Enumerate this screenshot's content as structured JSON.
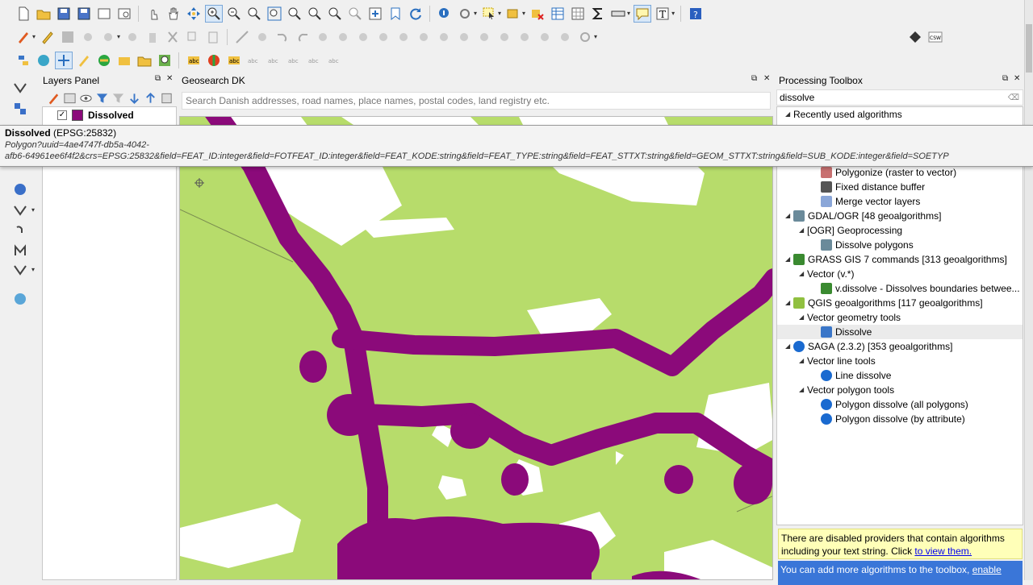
{
  "layers_panel": {
    "title": "Layers Panel",
    "layers": [
      {
        "name": "Dissolved",
        "checked": true,
        "color": "#8b0a7a"
      }
    ]
  },
  "geosearch": {
    "title": "Geosearch DK",
    "placeholder": "Search Danish addresses, road names, place names, postal codes, land registry etc."
  },
  "tooltip": {
    "layer_name": "Dissolved",
    "crs": "(EPSG:25832)",
    "uri_line1": "Polygon?uuid=4ae4747f-db5a-4042-",
    "uri_line2": "afb6-64961ee6f4f2&crs=EPSG:25832&field=FEAT_ID:integer&field=FOTFEAT_ID:integer&field=FEAT_KODE:string&field=FEAT_TYPE:string&field=FEAT_STTXT:string&field=GEOM_STTXT:string&field=SUB_KODE:integer&field=SOETYP"
  },
  "processing": {
    "title": "Processing Toolbox",
    "search_value": "dissolve",
    "tree": [
      {
        "label": "Recently used algorithms",
        "level": 0,
        "expander": "◢",
        "icon": "none"
      },
      {
        "label": "Polygonize (raster to vector)",
        "level": 2,
        "icon": "polygonize-icon"
      },
      {
        "label": "Fixed distance buffer",
        "level": 2,
        "icon": "buffer-icon"
      },
      {
        "label": "Merge vector layers",
        "level": 2,
        "icon": "merge-icon"
      },
      {
        "label": "GDAL/OGR [48 geoalgorithms]",
        "level": 0,
        "expander": "◢",
        "icon": "gdal-icon"
      },
      {
        "label": "[OGR] Geoprocessing",
        "level": 1,
        "expander": "◢",
        "icon": "none"
      },
      {
        "label": "Dissolve polygons",
        "level": 2,
        "icon": "gdal-icon"
      },
      {
        "label": "GRASS GIS 7 commands [313 geoalgorithms]",
        "level": 0,
        "expander": "◢",
        "icon": "grass-icon"
      },
      {
        "label": "Vector (v.*)",
        "level": 1,
        "expander": "◢",
        "icon": "none"
      },
      {
        "label": "v.dissolve - Dissolves boundaries betwee...",
        "level": 2,
        "icon": "grass-icon"
      },
      {
        "label": "QGIS geoalgorithms [117 geoalgorithms]",
        "level": 0,
        "expander": "◢",
        "icon": "qgis-icon"
      },
      {
        "label": "Vector geometry tools",
        "level": 1,
        "expander": "◢",
        "icon": "none"
      },
      {
        "label": "Dissolve",
        "level": 2,
        "icon": "dissolve-icon",
        "selected": true
      },
      {
        "label": "SAGA (2.3.2) [353 geoalgorithms]",
        "level": 0,
        "expander": "◢",
        "icon": "saga-icon"
      },
      {
        "label": "Vector line tools",
        "level": 1,
        "expander": "◢",
        "icon": "none"
      },
      {
        "label": "Line dissolve",
        "level": 2,
        "icon": "saga-icon"
      },
      {
        "label": "Vector polygon tools",
        "level": 1,
        "expander": "◢",
        "icon": "none"
      },
      {
        "label": "Polygon dissolve (all polygons)",
        "level": 2,
        "icon": "saga-icon"
      },
      {
        "label": "Polygon dissolve (by attribute)",
        "level": 2,
        "icon": "saga-icon"
      }
    ],
    "warning_text": "There are disabled providers that contain algorithms including your text string. Click ",
    "warning_link": "to view them.",
    "info_text": "You can add more algorithms to the toolbox, ",
    "info_link": "enable"
  },
  "colors": {
    "land": "#b7dc6b",
    "dissolved": "#8b0a7a",
    "white_area": "#ffffff"
  }
}
